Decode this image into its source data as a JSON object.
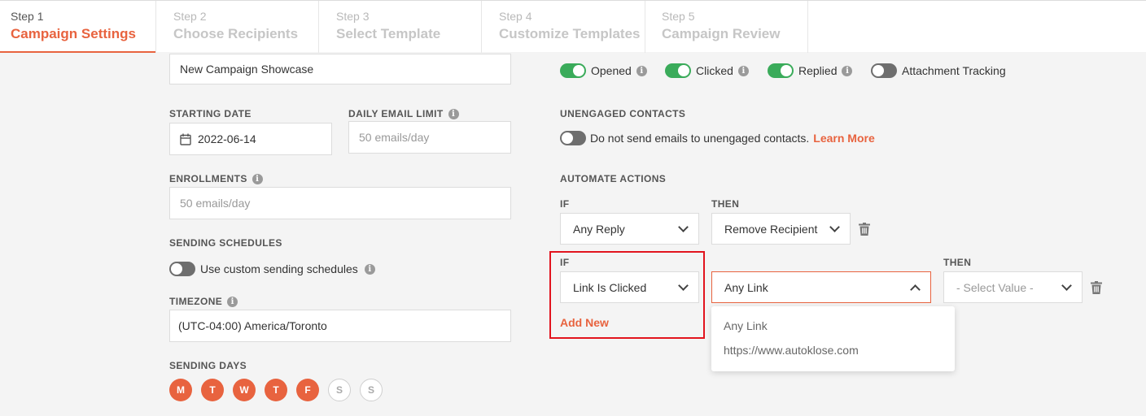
{
  "steps": [
    {
      "num": "Step 1",
      "name": "Campaign Settings"
    },
    {
      "num": "Step 2",
      "name": "Choose Recipients"
    },
    {
      "num": "Step 3",
      "name": "Select Template"
    },
    {
      "num": "Step 4",
      "name": "Customize Templates"
    },
    {
      "num": "Step 5",
      "name": "Campaign Review"
    }
  ],
  "left": {
    "campaign_name": "New Campaign Showcase",
    "starting_date_label": "STARTING DATE",
    "starting_date": "2022-06-14",
    "daily_limit_label": "DAILY EMAIL LIMIT",
    "daily_limit_placeholder": "50 emails/day",
    "enrollments_label": "ENROLLMENTS",
    "enrollments_placeholder": "50 emails/day",
    "sending_schedules_label": "SENDING SCHEDULES",
    "custom_schedules_text": "Use custom sending schedules",
    "timezone_label": "TIMEZONE",
    "timezone": "(UTC-04:00) America/Toronto",
    "sending_days_label": "SENDING DAYS",
    "days": [
      "M",
      "T",
      "W",
      "T",
      "F",
      "S",
      "S"
    ]
  },
  "tracking": {
    "opened": "Opened",
    "clicked": "Clicked",
    "replied": "Replied",
    "attachment": "Attachment Tracking"
  },
  "unengaged": {
    "label": "UNENGAGED CONTACTS",
    "text": "Do not send emails to unengaged contacts.",
    "learn_more": "Learn More"
  },
  "automate": {
    "label": "AUTOMATE ACTIONS",
    "if_label": "IF",
    "then_label": "THEN",
    "rule1_if": "Any Reply",
    "rule1_then": "Remove Recipient",
    "rule2_if": "Link Is Clicked",
    "rule2_link": "Any Link",
    "rule2_value_placeholder": "- Select Value -",
    "add_new": "Add New",
    "link_options": [
      "Any Link",
      "https://www.autoklose.com"
    ]
  },
  "colors": {
    "accent": "#e8633f",
    "toggle_on": "#3aab5a",
    "highlight": "#e2141e"
  }
}
